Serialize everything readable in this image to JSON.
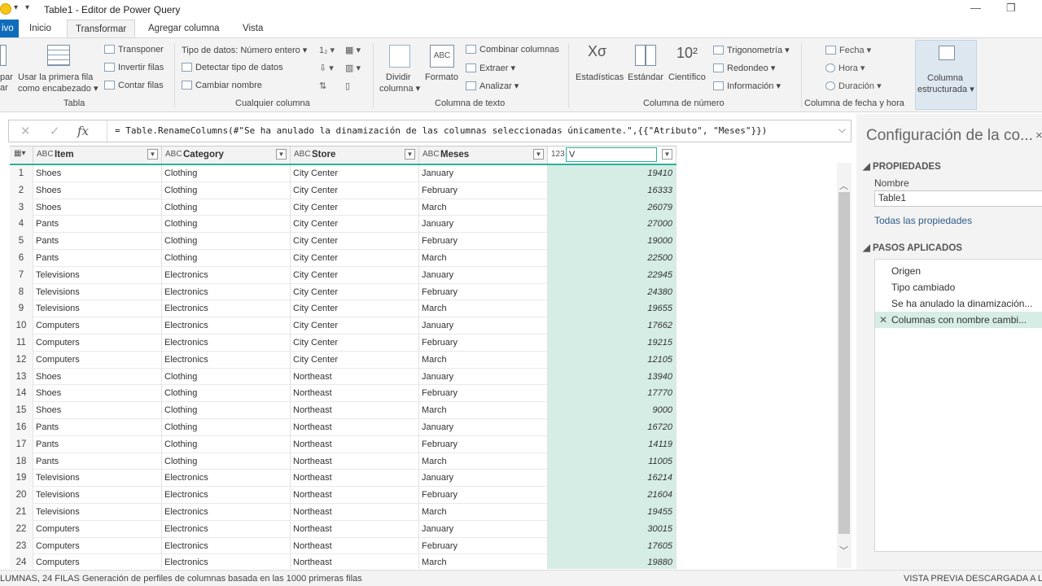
{
  "window": {
    "title": "Table1 - Editor de Power Query"
  },
  "tabs": [
    {
      "label": "ivo"
    },
    {
      "label": "Inicio"
    },
    {
      "label": "Transformar"
    },
    {
      "label": "Agregar columna"
    },
    {
      "label": "Vista"
    }
  ],
  "ribbon": {
    "tabla": {
      "group_label": "Tabla",
      "agrupar_part": "par",
      "agrupar_part2": "ar",
      "use_first_row_1": "Usar la primera fila",
      "use_first_row_2": "como encabezado",
      "transponer": "Transponer",
      "invertir_filas": "Invertir filas",
      "contar_filas": "Contar filas"
    },
    "cualquier_columna": {
      "group_label": "Cualquier columna",
      "tipo_datos": "Tipo de datos: Número entero",
      "detectar_tipo": "Detectar tipo de datos",
      "cambiar_nombre": "Cambiar nombre"
    },
    "columna_texto": {
      "group_label": "Columna de texto",
      "dividir_1": "Dividir",
      "dividir_2": "columna",
      "formato": "Formato",
      "combinar": "Combinar columnas",
      "extraer": "Extraer",
      "analizar": "Analizar"
    },
    "columna_numero": {
      "group_label": "Columna de número",
      "estadisticas": "Estadísticas",
      "estandar": "Estándar",
      "cientifico": "Científico",
      "trigonometria": "Trigonometría",
      "redondeo": "Redondeo",
      "informacion": "Información"
    },
    "columna_fecha": {
      "group_label": "Columna de fecha y hora",
      "fecha": "Fecha",
      "hora": "Hora",
      "duracion": "Duración"
    },
    "estructurada": {
      "label_1": "Columna",
      "label_2": "estructurada"
    }
  },
  "formula_bar": {
    "formula": "= Table.RenameColumns(#\"Se ha anulado la dinamización de las columnas seleccionadas únicamente.\",{{\"Atributo\", \"Meses\"}})"
  },
  "grid": {
    "columns": [
      {
        "type_icon": "ABC",
        "name": "Item"
      },
      {
        "type_icon": "ABC",
        "name": "Category"
      },
      {
        "type_icon": "ABC",
        "name": "Store"
      },
      {
        "type_icon": "ABC",
        "name": "Meses"
      },
      {
        "type_icon": "123",
        "name": "V",
        "editing": true
      }
    ],
    "rows": [
      [
        "1",
        "Shoes",
        "Clothing",
        "City Center",
        "January",
        "19410"
      ],
      [
        "2",
        "Shoes",
        "Clothing",
        "City Center",
        "February",
        "16333"
      ],
      [
        "3",
        "Shoes",
        "Clothing",
        "City Center",
        "March",
        "26079"
      ],
      [
        "4",
        "Pants",
        "Clothing",
        "City Center",
        "January",
        "27000"
      ],
      [
        "5",
        "Pants",
        "Clothing",
        "City Center",
        "February",
        "19000"
      ],
      [
        "6",
        "Pants",
        "Clothing",
        "City Center",
        "March",
        "22500"
      ],
      [
        "7",
        "Televisions",
        "Electronics",
        "City Center",
        "January",
        "22945"
      ],
      [
        "8",
        "Televisions",
        "Electronics",
        "City Center",
        "February",
        "24380"
      ],
      [
        "9",
        "Televisions",
        "Electronics",
        "City Center",
        "March",
        "19655"
      ],
      [
        "10",
        "Computers",
        "Electronics",
        "City Center",
        "January",
        "17662"
      ],
      [
        "11",
        "Computers",
        "Electronics",
        "City Center",
        "February",
        "19215"
      ],
      [
        "12",
        "Computers",
        "Electronics",
        "City Center",
        "March",
        "12105"
      ],
      [
        "13",
        "Shoes",
        "Clothing",
        "Northeast",
        "January",
        "13940"
      ],
      [
        "14",
        "Shoes",
        "Clothing",
        "Northeast",
        "February",
        "17770"
      ],
      [
        "15",
        "Shoes",
        "Clothing",
        "Northeast",
        "March",
        "9000"
      ],
      [
        "16",
        "Pants",
        "Clothing",
        "Northeast",
        "January",
        "16720"
      ],
      [
        "17",
        "Pants",
        "Clothing",
        "Northeast",
        "February",
        "14119"
      ],
      [
        "18",
        "Pants",
        "Clothing",
        "Northeast",
        "March",
        "11005"
      ],
      [
        "19",
        "Televisions",
        "Electronics",
        "Northeast",
        "January",
        "16214"
      ],
      [
        "20",
        "Televisions",
        "Electronics",
        "Northeast",
        "February",
        "21604"
      ],
      [
        "21",
        "Televisions",
        "Electronics",
        "Northeast",
        "March",
        "19455"
      ],
      [
        "22",
        "Computers",
        "Electronics",
        "Northeast",
        "January",
        "30015"
      ],
      [
        "23",
        "Computers",
        "Electronics",
        "Northeast",
        "February",
        "17605"
      ],
      [
        "24",
        "Computers",
        "Electronics",
        "Northeast",
        "March",
        "19880"
      ]
    ]
  },
  "query_settings": {
    "title": "Configuración de la co...",
    "close": "×",
    "properties_heading": "PROPIEDADES",
    "name_label": "Nombre",
    "name_value": "Table1",
    "all_properties": "Todas las propiedades",
    "steps_heading": "PASOS APLICADOS",
    "steps": [
      "Origen",
      "Tipo cambiado",
      "Se ha anulado la dinamización...",
      "Columnas con nombre cambi..."
    ],
    "selected_step_index": 3
  },
  "status_bar": {
    "left": "LUMNAS, 24 FILAS",
    "profiling": "Generación de perfiles de columnas basada en las 1000 primeras filas",
    "right": "VISTA PREVIA DESCARGADA A LAS"
  },
  "colors": {
    "accent": "#0f6cbd",
    "teal": "#2bb39a",
    "selected_column_bg": "#d6ede6"
  }
}
